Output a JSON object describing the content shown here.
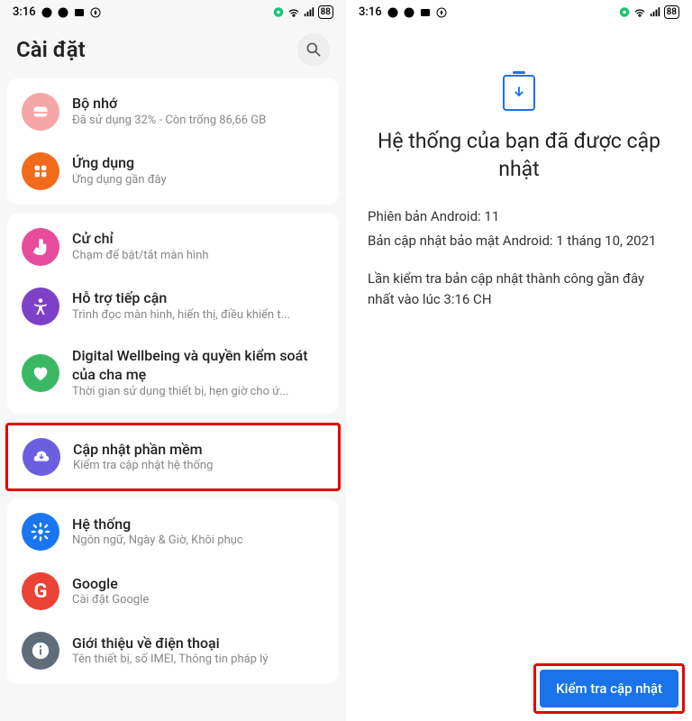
{
  "status": {
    "time": "3:16",
    "battery": "88"
  },
  "left": {
    "title": "Cài đặt",
    "items": {
      "storage": {
        "title": "Bộ nhớ",
        "sub": "Đã sử dụng 32% - Còn trống 86,66 GB"
      },
      "apps": {
        "title": "Ứng dụng",
        "sub": "Ứng dụng gần đây"
      },
      "gesture": {
        "title": "Cử chỉ",
        "sub": "Chạm để bật/tắt màn hình"
      },
      "access": {
        "title": "Hỗ trợ tiếp cận",
        "sub": "Trình đọc màn hình, hiển thị, điều khiển t..."
      },
      "wellbeing": {
        "title": "Digital Wellbeing và quyền kiểm soát của cha mẹ",
        "sub": "Thời gian sử dụng thiết bị, hẹn giờ cho ứ..."
      },
      "update": {
        "title": "Cập nhật phần mềm",
        "sub": "Kiểm tra cập nhật hệ thống"
      },
      "system": {
        "title": "Hệ thống",
        "sub": "Ngôn ngữ, Ngày & Giờ, Khôi phục"
      },
      "google": {
        "title": "Google",
        "sub": "Cài đặt Google"
      },
      "about": {
        "title": "Giới thiệu về điện thoại",
        "sub": "Tên thiết bị, số IMEI, Thông tin pháp lý"
      }
    }
  },
  "right": {
    "heading": "Hệ thống của bạn đã được cập nhật",
    "android_version_label": "Phiên bản Android: 11",
    "security_label": "Bản cập nhật bảo mật Android: 1 tháng 10, 2021",
    "last_check": "Lần kiểm tra bản cập nhật thành công gần đây nhất vào lúc 3:16 CH",
    "button": "Kiểm tra cập nhật"
  }
}
